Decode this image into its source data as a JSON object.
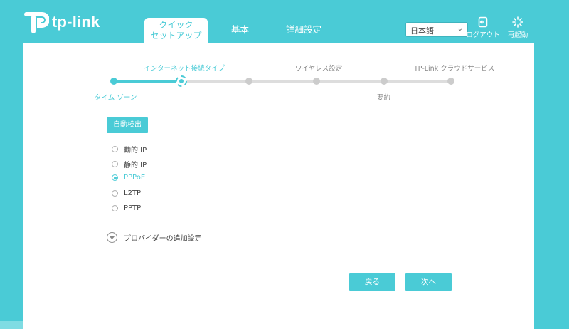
{
  "header": {
    "brand": "tp-link",
    "tabs": [
      {
        "label_line1": "クイック",
        "label_line2": "セットアップ",
        "active": true
      },
      {
        "label": "基本",
        "active": false
      },
      {
        "label": "詳細設定",
        "active": false
      }
    ],
    "language": {
      "selected": "日本語"
    },
    "logout_label": "ログアウト",
    "reboot_label": "再起動"
  },
  "wizard": {
    "steps_top": [
      "インターネット接続タイプ",
      "ワイヤレス設定",
      "TP-Link クラウドサービス"
    ],
    "steps_bottom": [
      "タイム ゾーン",
      "要約"
    ],
    "active_step": "インターネット接続タイプ",
    "completed_step": "タイム ゾーン"
  },
  "form": {
    "autodetect_label": "自動検出",
    "connection_types": [
      {
        "label": "動的 IP",
        "selected": false
      },
      {
        "label": "静的 IP",
        "selected": false
      },
      {
        "label": "PPPoE",
        "selected": true
      },
      {
        "label": "L2TP",
        "selected": false
      },
      {
        "label": "PPTP",
        "selected": false
      }
    ],
    "provider_settings_label": "プロバイダーの追加設定"
  },
  "buttons": {
    "back_label": "戻る",
    "next_label": "次へ"
  },
  "colors": {
    "accent": "#4acbd6",
    "background": "#4acbd6",
    "panel": "#ffffff"
  }
}
